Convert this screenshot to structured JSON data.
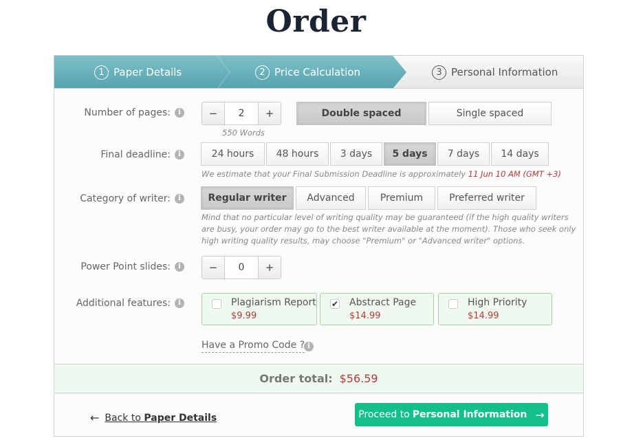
{
  "page": {
    "title": "Order"
  },
  "steps": [
    {
      "num": "1",
      "label": "Paper Details",
      "state": "done"
    },
    {
      "num": "2",
      "label": "Price Calculation",
      "state": "active"
    },
    {
      "num": "3",
      "label": "Personal Information",
      "state": "pending"
    }
  ],
  "pages": {
    "label": "Number of pages:",
    "minus": "−",
    "plus": "+",
    "value": "2",
    "words_hint": "550 Words",
    "spacing_options": [
      {
        "label": "Double spaced",
        "selected": true
      },
      {
        "label": "Single spaced",
        "selected": false
      }
    ]
  },
  "deadline": {
    "label": "Final deadline:",
    "options": [
      {
        "label": "24 hours",
        "selected": false
      },
      {
        "label": "48 hours",
        "selected": false
      },
      {
        "label": "3 days",
        "selected": false
      },
      {
        "label": "5 days",
        "selected": true
      },
      {
        "label": "7 days",
        "selected": false
      },
      {
        "label": "14 days",
        "selected": false
      }
    ],
    "estimate_text": "We estimate that your Final Submission Deadline is approximately",
    "estimate_date": "11 Jun 10 AM (GMT +3)"
  },
  "writer": {
    "label": "Category of writer:",
    "options": [
      {
        "label": "Regular writer",
        "selected": true
      },
      {
        "label": "Advanced",
        "selected": false
      },
      {
        "label": "Premium",
        "selected": false
      },
      {
        "label": "Preferred writer",
        "selected": false
      }
    ],
    "note_line1": "Mind that no particular level of writing quality may be guaranteed (if the high quality writers",
    "note_line2": "are busy, your order may go to the best writer available at the moment). Those who seek only",
    "note_line3": "high writing quality results, may choose \"Premium\" or \"Advanced writer\" options."
  },
  "slides": {
    "label": "Power Point slides:",
    "minus": "−",
    "plus": "+",
    "value": "0"
  },
  "features": {
    "label": "Additional features:",
    "items": [
      {
        "name": "Plagiarism Report",
        "price": "$9.99",
        "checked": false,
        "mark": ""
      },
      {
        "name": "Abstract Page",
        "price": "$14.99",
        "checked": true,
        "mark": "✔"
      },
      {
        "name": "High Priority",
        "price": "$14.99",
        "checked": false,
        "mark": ""
      }
    ]
  },
  "promo": {
    "label": "Have a Promo Code ?"
  },
  "info_glyph": "i",
  "total": {
    "label": "Order total:",
    "amount": "$56.59"
  },
  "footer": {
    "back_arrow": "←",
    "back_prefix": "Back to ",
    "back_target": "Paper Details",
    "proceed_prefix": "Proceed to",
    "proceed_target": "Personal Information",
    "proceed_arrow": "→"
  },
  "colors": {
    "accent_teal": "#5fa9b3",
    "proceed_green": "#13c08a",
    "price_red": "#b23b3b",
    "feature_bg": "#f0f9ef"
  }
}
